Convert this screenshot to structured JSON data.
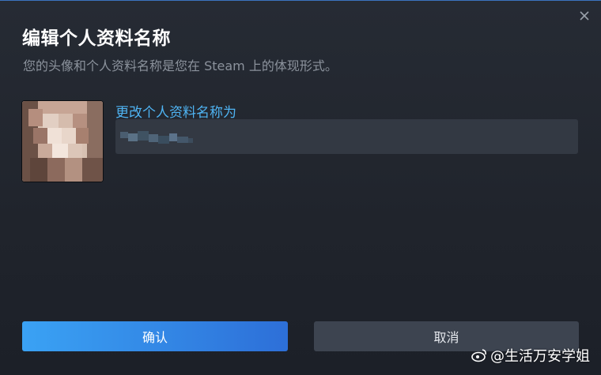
{
  "dialog": {
    "title": "编辑个人资料名称",
    "subtitle": "您的头像和个人资料名称是您在 Steam 上的体现形式。",
    "close_icon": "close-icon"
  },
  "profile": {
    "avatar_icon": "avatar",
    "field_label": "更改个人资料名称为",
    "name_value": ""
  },
  "buttons": {
    "confirm_label": "确认",
    "cancel_label": "取消"
  },
  "watermark": {
    "text": "@生活万安学姐",
    "icon": "weibo-icon"
  },
  "colors": {
    "accent": "#4fb4f3",
    "confirm_start": "#3aa2f4",
    "confirm_end": "#2d6fd8",
    "background": "#23272f"
  }
}
